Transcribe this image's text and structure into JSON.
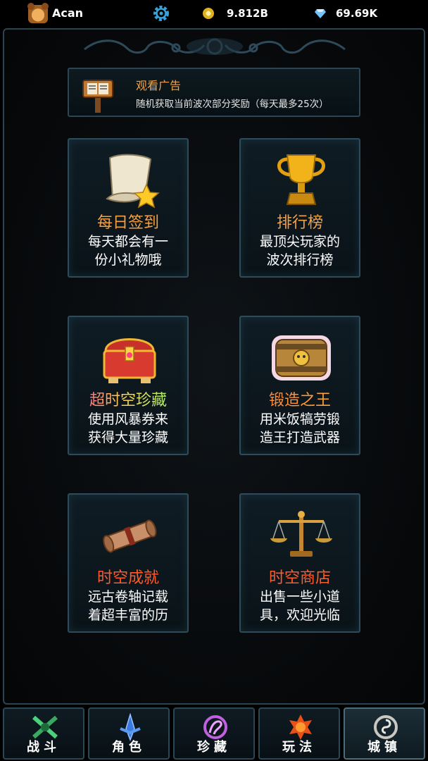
{
  "topbar": {
    "username": "Acan",
    "gold": "9.812B",
    "gems": "69.69K",
    "icons": {
      "avatar": "bear-avatar",
      "settings": "gear-icon",
      "gold": "coin-icon",
      "gems": "diamond-icon"
    }
  },
  "ad_banner": {
    "title": "观看广告",
    "description": "随机获取当前波次部分奖励（每天最多25次）",
    "icon": "signboard-icon"
  },
  "cards": [
    {
      "title": "每日签到",
      "description_lines": [
        "每天都会有一",
        "份小礼物哦"
      ],
      "icon": "scroll-star-icon"
    },
    {
      "title": "排行榜",
      "description_lines": [
        "最顶尖玩家的",
        "波次排行榜"
      ],
      "icon": "trophy-icon"
    },
    {
      "title": "超时空珍藏",
      "description_lines": [
        "使用风暴券来",
        "获得大量珍藏"
      ],
      "icon": "treasure-chest-icon"
    },
    {
      "title": "锻造之王",
      "description_lines": [
        "用米饭犒劳锻",
        "造王打造武器"
      ],
      "icon": "forge-barrel-icon"
    },
    {
      "title": "时空成就",
      "description_lines": [
        "远古卷轴记载",
        "着超丰富的历"
      ],
      "icon": "ancient-scroll-icon"
    },
    {
      "title": "时空商店",
      "description_lines": [
        "出售一些小道",
        "具，欢迎光临"
      ],
      "icon": "balance-scale-icon"
    }
  ],
  "nav": {
    "tabs": [
      {
        "label": "战斗",
        "icon": "crossed-swords-icon",
        "active": false
      },
      {
        "label": "角色",
        "icon": "blue-blade-icon",
        "active": false
      },
      {
        "label": "珍藏",
        "icon": "purple-rune-icon",
        "active": false
      },
      {
        "label": "玩法",
        "icon": "fire-emblem-icon",
        "active": false
      },
      {
        "label": "城镇",
        "icon": "town-spiral-icon",
        "active": true
      }
    ]
  },
  "colors": {
    "accent_orange": "#f5a043",
    "accent_red": "#ff5a2a",
    "card_border": "#2f4a58"
  }
}
